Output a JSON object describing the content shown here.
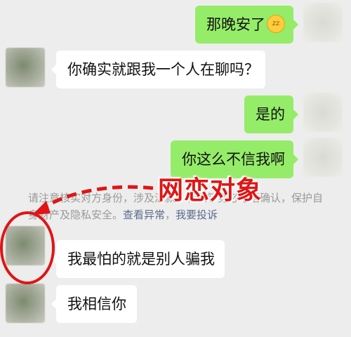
{
  "messages": [
    {
      "side": "right",
      "text": "那晚安了",
      "emoji": "sleeping-face"
    },
    {
      "side": "left",
      "text": "你确实就跟我一个人在聊吗？"
    },
    {
      "side": "right",
      "text": "是的"
    },
    {
      "side": "right",
      "text": "你这么不信我啊"
    },
    {
      "side": "left",
      "text": "我最怕的就是别人骗我"
    },
    {
      "side": "left",
      "text": "我相信你"
    }
  ],
  "notice": {
    "text": "请注意核实对方身份，涉及汇款、转账等务必电话确认，保护自身财产及隐私安全。",
    "link_check": "查看异常",
    "separator": "，",
    "link_report": "我要投诉"
  },
  "annotation": {
    "label": "网恋对象",
    "color": "#e01515"
  },
  "colors": {
    "background": "#ededed",
    "bubble_self": "#95ec69",
    "bubble_other": "#ffffff"
  }
}
